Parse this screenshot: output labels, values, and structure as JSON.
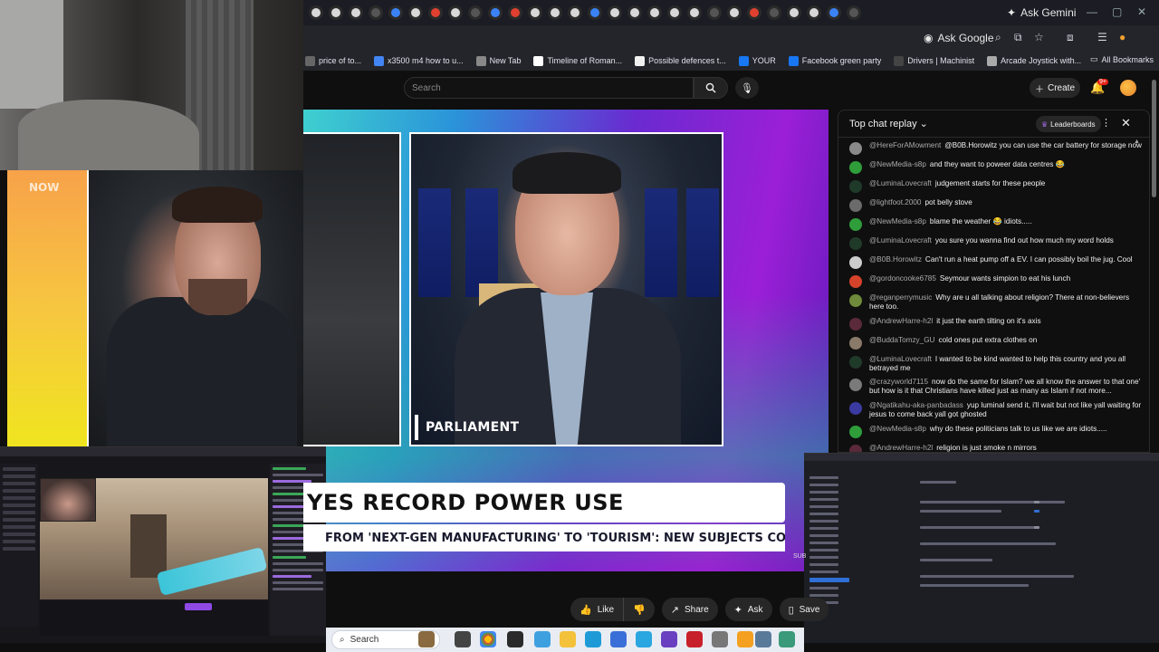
{
  "browser": {
    "ask_gemini": "Ask Gemini",
    "ask_google": "Ask Google",
    "bookmarks": [
      {
        "label": "price of to...",
        "color": "#666666"
      },
      {
        "label": "x3500 m4 how to u...",
        "color": "#4285f4"
      },
      {
        "label": "New Tab",
        "color": "#888888"
      },
      {
        "label": "Timeline of Roman...",
        "color": "#ffffff"
      },
      {
        "label": "Possible defences t...",
        "color": "#f1f1f1"
      },
      {
        "label": "YOUR",
        "color": "#1877f2"
      },
      {
        "label": "Facebook green party",
        "color": "#1877f2"
      },
      {
        "label": "Drivers | Machinist",
        "color": "#444444"
      },
      {
        "label": "Arcade Joystick with...",
        "color": "#aaaaaa"
      }
    ],
    "all_bookmarks": "All Bookmarks"
  },
  "youtube": {
    "search_placeholder": "Search",
    "create_label": "Create",
    "notification_count": "9+"
  },
  "video": {
    "lower_third": "PARLIAMENT",
    "headline": "YES RECORD POWER USE",
    "ticker": "FROM 'NEXT-GEN MANUFACTURING' TO 'TOURISM': NEW SUBJECTS CO",
    "corner_tag": "SUB",
    "overlay_tag": "NOW"
  },
  "actions": {
    "like": "Like",
    "share": "Share",
    "ask": "Ask",
    "save": "Save"
  },
  "chat": {
    "title": "Top chat replay",
    "leaderboards": "Leaderboards",
    "messages": [
      {
        "author": "@HereForAMowment",
        "text": "@B0B.Horowitz you can use the car battery for storage now",
        "avatar": "#8a8a8a"
      },
      {
        "author": "@NewMedia-s8p",
        "text": "and they want to poweer data centres 😂",
        "avatar": "#2e9d3a"
      },
      {
        "author": "@LuminaLovecraft",
        "text": "judgement starts for these people",
        "avatar": "#203a2a"
      },
      {
        "author": "@lightfoot.2000",
        "text": "pot belly stove",
        "avatar": "#6b6b6b"
      },
      {
        "author": "@NewMedia-s8p",
        "text": "blame the weather 😂 idiots.....",
        "avatar": "#2e9d3a"
      },
      {
        "author": "@LuminaLovecraft",
        "text": "you sure you wanna find out how much my word holds",
        "avatar": "#203a2a"
      },
      {
        "author": "@B0B.Horowitz",
        "text": "Can't run a heat pump off a EV. I can possibly boil the jug. Cool",
        "avatar": "#cccccc"
      },
      {
        "author": "@gordoncooke6785",
        "text": "Seymour wants simpion to eat his lunch",
        "avatar": "#d5432b"
      },
      {
        "author": "@reganperrymusic",
        "text": "Why are u all talking about religion? There at non-believers here too.",
        "avatar": "#6e8a3a"
      },
      {
        "author": "@AndrewHarre-h2l",
        "text": "it just the earth tilting on it's axis",
        "avatar": "#5a2a3a"
      },
      {
        "author": "@BuddaTomzy_GU",
        "text": "cold ones put extra clothes on",
        "avatar": "#8a7a6a"
      },
      {
        "author": "@LuminaLovecraft",
        "text": "I wanted to be kind wanted to help this country and you all betrayed me",
        "avatar": "#203a2a"
      },
      {
        "author": "@crazyworld7115",
        "text": "now do the same for Islam? we all know the answer to that one' but how is it that Christians have killed just as many as Islam if not more...",
        "avatar": "#7a7a7a"
      },
      {
        "author": "@Ngatikahu-aka-panbadass",
        "text": "yup luminal send it, i'll wait but not like yall waiting for jesus to come back yall got ghosted",
        "avatar": "#3a3aa0"
      },
      {
        "author": "@NewMedia-s8p",
        "text": "why do these politicians talk to us like we are idiots.....",
        "avatar": "#2e9d3a"
      },
      {
        "author": "@AndrewHarre-h2l",
        "text": "religion is just smoke n mirrors",
        "avatar": "#5a2a3a"
      }
    ]
  },
  "taskbar": {
    "search": "Search"
  }
}
